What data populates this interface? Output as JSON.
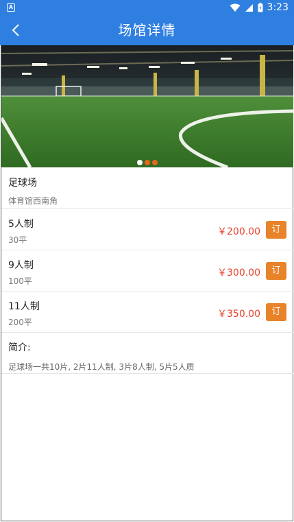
{
  "status_bar": {
    "notification_badge": "A",
    "time": "3:23",
    "icons": [
      "wifi-icon",
      "signal-icon",
      "battery-icon"
    ]
  },
  "header": {
    "title": "场馆详情",
    "back_icon": "chevron-left-icon"
  },
  "banner": {
    "dots": 3,
    "active_dot": 0
  },
  "venue": {
    "name": "足球场",
    "address": "体育馆西南角"
  },
  "options": [
    {
      "name": "5人制",
      "size": "30平",
      "price": "￥200.00",
      "book_label": "订"
    },
    {
      "name": "9人制",
      "size": "100平",
      "price": "￥300.00",
      "book_label": "订"
    },
    {
      "name": "11人制",
      "size": "200平",
      "price": "￥350.00",
      "book_label": "订"
    }
  ],
  "intro": {
    "title": "简介:",
    "text": "足球场一共10片, 2片11人制, 3片8人制, 5片5人质"
  },
  "colors": {
    "primary": "#2f7fe0",
    "price": "#e8412c",
    "book_button": "#e8832a"
  }
}
